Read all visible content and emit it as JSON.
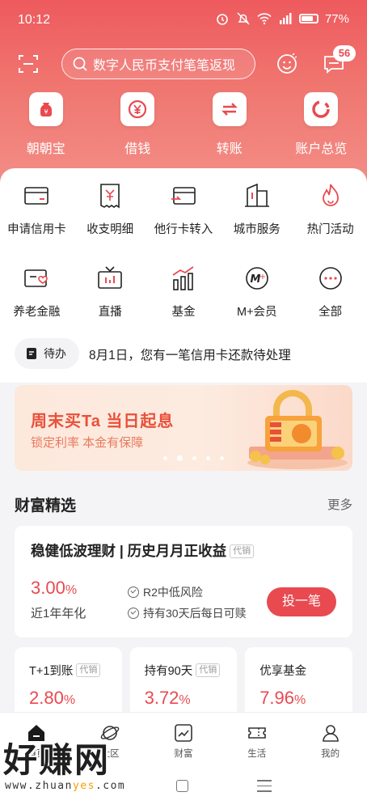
{
  "status": {
    "time": "10:12",
    "battery": "77%"
  },
  "header": {
    "search_placeholder": "数字人民币支付笔笔返现",
    "message_count": "56"
  },
  "quick_actions": [
    {
      "label": "朝朝宝",
      "icon": "money-bag-icon"
    },
    {
      "label": "借钱",
      "icon": "yuan-coin-icon"
    },
    {
      "label": "转账",
      "icon": "transfer-arrows-icon"
    },
    {
      "label": "账户总览",
      "icon": "ring-chart-icon"
    }
  ],
  "services_row1": [
    {
      "label": "申请信用卡",
      "icon": "credit-card-icon"
    },
    {
      "label": "收支明细",
      "icon": "receipt-icon"
    },
    {
      "label": "他行卡转入",
      "icon": "card-transfer-icon"
    },
    {
      "label": "城市服务",
      "icon": "building-icon"
    },
    {
      "label": "热门活动",
      "icon": "flame-icon"
    }
  ],
  "services_row2": [
    {
      "label": "养老金融",
      "icon": "pension-card-icon"
    },
    {
      "label": "直播",
      "icon": "tv-icon"
    },
    {
      "label": "基金",
      "icon": "bar-chart-icon"
    },
    {
      "label": "M+会员",
      "icon": "m-plus-icon"
    },
    {
      "label": "全部",
      "icon": "more-dots-icon"
    }
  ],
  "todo": {
    "pill": "待办",
    "text": "8月1日，您有一笔信用卡还款待处理"
  },
  "banner": {
    "title": "周末买Ta 当日起息",
    "subtitle": "锁定利率 本金有保障"
  },
  "wealth": {
    "section_title": "财富精选",
    "more": "更多",
    "card": {
      "title": "稳健低波理财 | 历史月月正收益",
      "tag": "代销",
      "rate": "3.00",
      "rate_unit": "%",
      "rate_label": "近1年年化",
      "feature1": "R2中低风险",
      "feature2": "持有30天后每日可赎",
      "button": "投一笔"
    },
    "mini": [
      {
        "title": "T+1到账",
        "tag": "代销",
        "rate": "2.80",
        "unit": "%"
      },
      {
        "title": "持有90天",
        "tag": "代销",
        "rate": "3.72",
        "unit": "%"
      },
      {
        "title": "优享基金",
        "tag": "",
        "rate": "7.96",
        "unit": "%"
      }
    ]
  },
  "tabs": [
    {
      "label": "首页",
      "icon": "home-icon"
    },
    {
      "label": "社区",
      "icon": "planet-icon"
    },
    {
      "label": "财富",
      "icon": "trend-chart-icon"
    },
    {
      "label": "生活",
      "icon": "ticket-icon"
    },
    {
      "label": "我的",
      "icon": "person-icon"
    }
  ],
  "watermark": {
    "text": "好赚网",
    "url_a": "www.zhuan",
    "url_b": "yes",
    "url_c": ".com"
  },
  "colors": {
    "brand": "#e84a50",
    "header_top": "#ee5a5e",
    "header_bottom": "#f39089"
  }
}
